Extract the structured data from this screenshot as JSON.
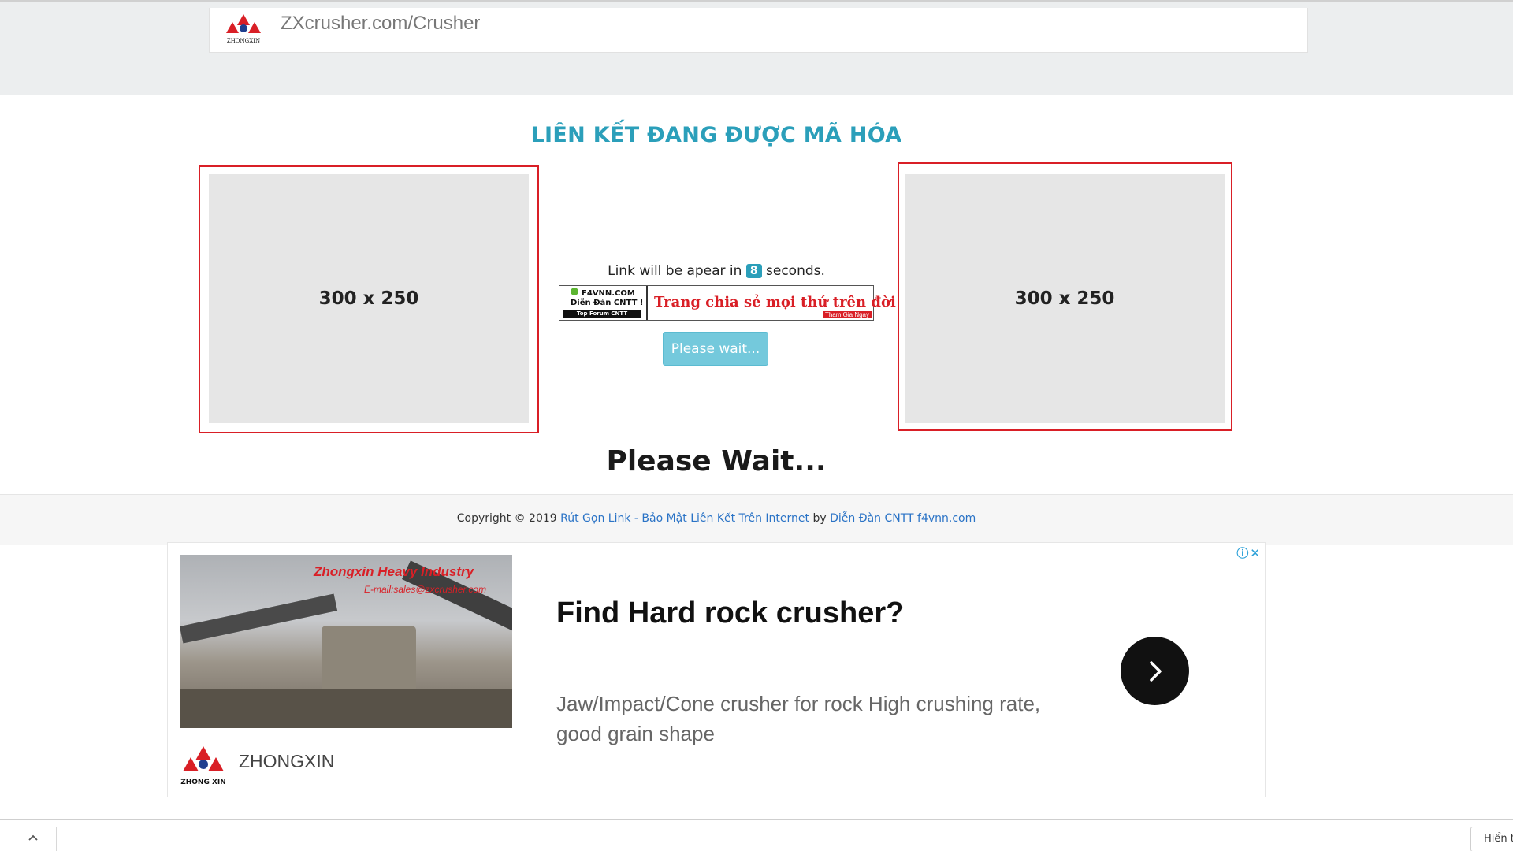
{
  "top_ad": {
    "logo_caption": "ZHONGXIN",
    "text": "ZXcrusher.com/Crusher"
  },
  "heading": "LIÊN KẾT ĐANG ĐƯỢC MÃ HÓA",
  "ad_left": {
    "label": "300 x 250"
  },
  "ad_right": {
    "label": "300 x 250"
  },
  "countdown": {
    "prefix": "Link will be apear in",
    "seconds": "8",
    "suffix": "seconds."
  },
  "banner": {
    "site": "F4VNN.COM",
    "forum": "Diễn Đàn CNTT !",
    "sub": "Top Forum CNTT",
    "slogan": "Trang chia sẻ mọi thứ trên đời",
    "tag": "Tham Gia Ngay"
  },
  "wait_button": {
    "label": "Please wait..."
  },
  "please_wait": "Please Wait...",
  "footer": {
    "copyright": "Copyright © 2019",
    "link1": "Rút Gọn Link - Bảo Mật Liên Kết Trên Internet",
    "by": "by",
    "link2": "Diễn Đàn CNTT f4vnn.com"
  },
  "bottom_ad": {
    "choices_icons": [
      "info-icon",
      "close-icon"
    ],
    "photo_brand": "Zhongxin Heavy Industry",
    "photo_mail": "E-mail:sales@zxcrusher.com",
    "logo_caption": "ZHONG XIN",
    "brand_name": "ZHONGXIN",
    "title": "Find Hard rock crusher?",
    "description": "Jaw/Impact/Cone crusher for rock High crushing rate, good grain shape",
    "cta_icon": "chevron-right-icon"
  },
  "downloads_bar": {
    "show_all_label": "Hiển thị tất cả"
  },
  "colors": {
    "accent": "#2b9fba",
    "ad_border": "#d91f26",
    "button": "#74c9dc",
    "link": "#2a73c6"
  }
}
